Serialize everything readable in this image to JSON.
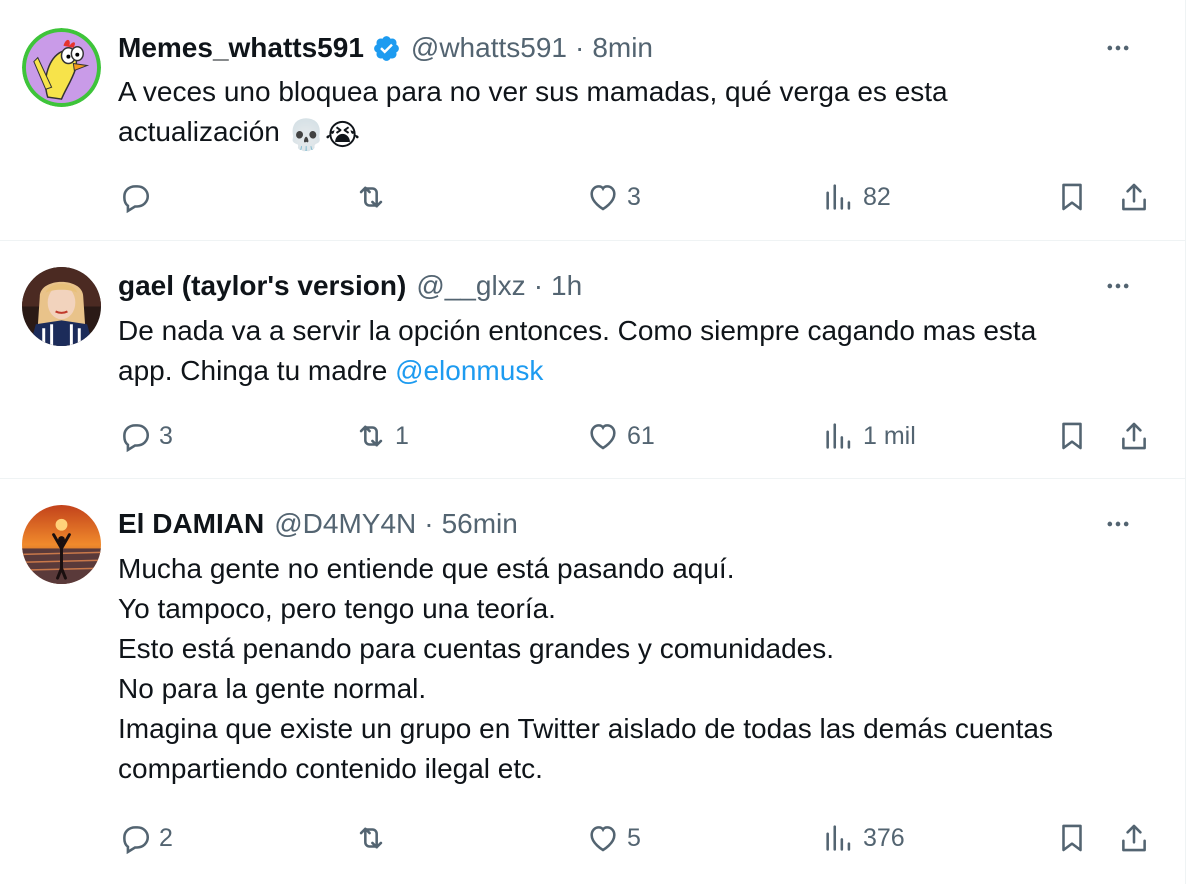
{
  "tweets": [
    {
      "name": "Memes_whatts591",
      "verified": true,
      "handle": "@whatts591",
      "separator": "·",
      "time": "8min",
      "text_lines": [
        "A veces uno bloquea para no ver sus mamadas, qué verga es esta",
        "actualización"
      ],
      "emojis": [
        "💀",
        "😭"
      ],
      "replies": "",
      "retweets": "",
      "likes": "3",
      "views": "82"
    },
    {
      "name": "gael (taylor's version)",
      "verified": false,
      "handle": "@__glxz",
      "separator": "·",
      "time": "1h",
      "text_line1": "De nada va a servir la opción entonces. Como siempre cagando mas esta",
      "text_line2_prefix": "app. Chinga tu madre ",
      "mention": "@elonmusk",
      "replies": "3",
      "retweets": "1",
      "likes": "61",
      "views": "1 mil"
    },
    {
      "name": "El DAMIAN",
      "verified": false,
      "handle": "@D4MY4N",
      "separator": "·",
      "time": "56min",
      "text_lines": [
        "Mucha gente no entiende que está pasando aquí.",
        "Yo tampoco, pero tengo una teoría.",
        "Esto está penando para cuentas grandes y comunidades.",
        "No para la gente normal.",
        "Imagina que existe un grupo en Twitter aislado de todas las demás cuentas",
        "compartiendo contenido ilegal etc."
      ],
      "replies": "2",
      "retweets": "",
      "likes": "5",
      "views": "376"
    }
  ],
  "colors": {
    "text": "#0f1419",
    "secondary": "#536471",
    "link": "#1d9bf0",
    "verified": "#1d9bf0",
    "divider": "#eff3f4"
  },
  "icons": [
    "reply-icon",
    "retweet-icon",
    "like-icon",
    "views-icon",
    "bookmark-icon",
    "share-icon",
    "more-icon",
    "verified-icon"
  ]
}
